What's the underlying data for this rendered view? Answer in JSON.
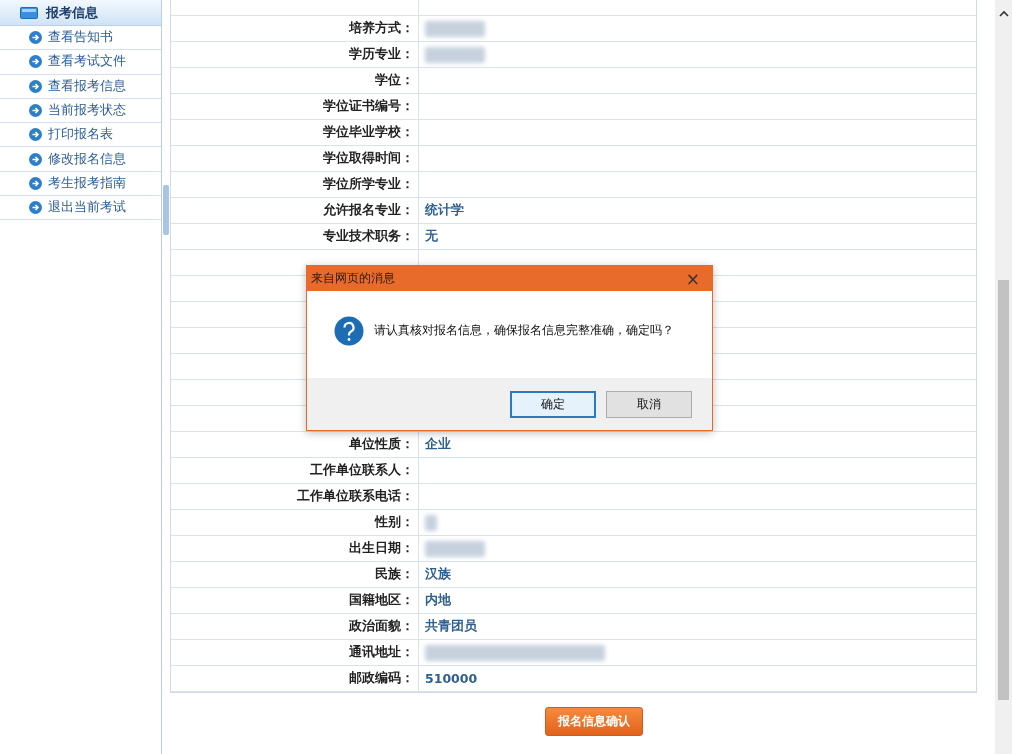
{
  "sidebar": {
    "title": "报考信息",
    "items": [
      {
        "label": "查看告知书"
      },
      {
        "label": "查看考试文件"
      },
      {
        "label": "查看报考信息"
      },
      {
        "label": "当前报考状态"
      },
      {
        "label": "打印报名表"
      },
      {
        "label": "修改报名信息"
      },
      {
        "label": "考生报考指南"
      },
      {
        "label": "退出当前考试"
      }
    ]
  },
  "form": {
    "rows_above": [
      {
        "label": "培养方式：",
        "blurred": true
      },
      {
        "label": "学历专业：",
        "blurred": true
      },
      {
        "label": "学位："
      },
      {
        "label": "学位证书编号："
      },
      {
        "label": "学位毕业学校："
      },
      {
        "label": "学位取得时间："
      },
      {
        "label": "学位所学专业："
      },
      {
        "label": "允许报名专业：",
        "value": "统计学"
      },
      {
        "label": "专业技术职务：",
        "value": "无"
      }
    ],
    "rows_below": [
      {
        "label": "单位性质：",
        "value": "企业"
      },
      {
        "label": "工作单位联系人："
      },
      {
        "label": "工作单位联系电话："
      },
      {
        "label": "性别：",
        "blurred": true
      },
      {
        "label": "出生日期：",
        "blurred": true
      },
      {
        "label": "民族：",
        "value": "汉族"
      },
      {
        "label": "国籍地区：",
        "value": "内地"
      },
      {
        "label": "政治面貌：",
        "value": "共青团员"
      },
      {
        "label": "通讯地址：",
        "blurred": true
      },
      {
        "label": "邮政编码：",
        "value": "510000"
      }
    ],
    "confirm_button": "报名信息确认"
  },
  "dialog": {
    "title": "来自网页的消息",
    "close": "×",
    "message": "请认真核对报名信息，确保报名信息完整准确，确定吗？",
    "buttons": [
      {
        "label": "确定",
        "default": true
      },
      {
        "label": "取消",
        "default": false
      }
    ]
  }
}
